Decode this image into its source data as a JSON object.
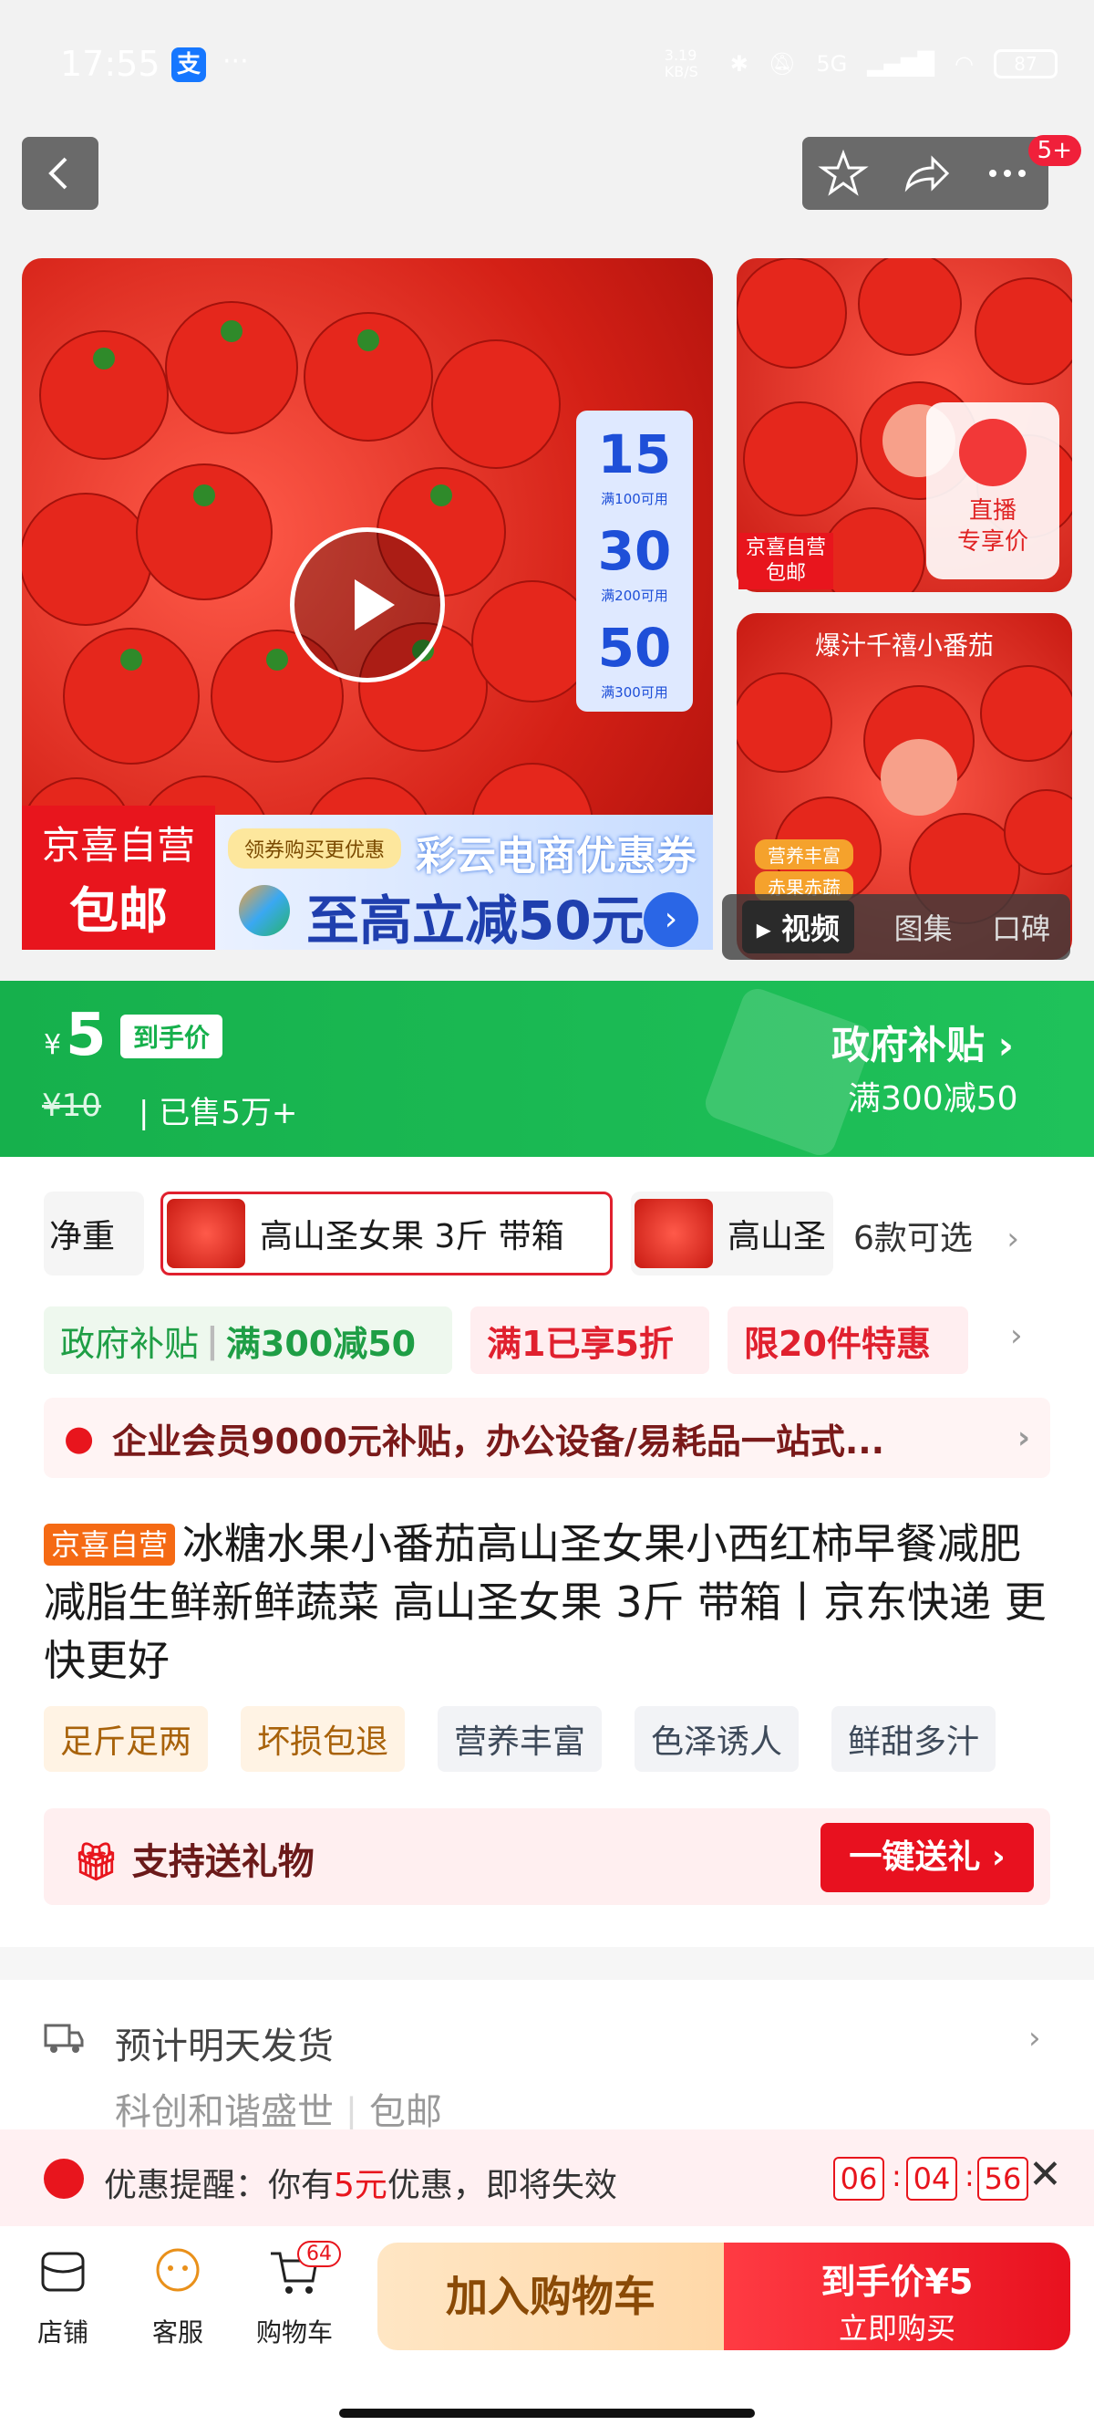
{
  "status_bar": {
    "time": "17:55",
    "alipay_icon": "支",
    "more": "···",
    "net_speed": "3.19 KB/S",
    "signal": "5G",
    "battery": "87"
  },
  "nav": {
    "badge": "5+"
  },
  "gallery": {
    "coupons": [
      {
        "value": "15",
        "cond": "满100可用"
      },
      {
        "value": "30",
        "cond": "满200可用"
      },
      {
        "value": "50",
        "cond": "满300可用"
      }
    ],
    "currency_small": "¥",
    "jx_line1": "京喜自营",
    "jx_line2": "包邮",
    "coupon_small": "领券购买更优惠",
    "coupon_title": "彩云电商优惠券",
    "coupon_main": "至高立减50元",
    "live_line1": "直播",
    "live_line2": "专享价",
    "side1_tag_l1": "京喜自营",
    "side1_tag_l2": "包邮",
    "side2_title": "爆汁千禧小番茄",
    "side2_tag1": "营养丰富",
    "side2_tag2": "赤果赤蔬",
    "tabs": [
      "视频",
      "图集",
      "口碑"
    ]
  },
  "price": {
    "currency": "¥",
    "value": "5",
    "tag": "到手价",
    "original": "¥10",
    "sold": "| 已售5万+",
    "gov_title": "政府补贴",
    "gov_sub": "满300减50"
  },
  "variants": {
    "chip0": "净重",
    "chip1": "高山圣女果 3斤 带箱",
    "chip2": "高山圣",
    "more": "6款可选"
  },
  "promos": {
    "gov": "政府补贴",
    "gov_detail": "满300减50",
    "p1": "满1已享5折",
    "p2": "限20件特惠"
  },
  "enterprise": "企业会员9000元补贴，办公设备/易耗品一站式...",
  "product": {
    "self_tag": "京喜自营",
    "title": "冰糖水果小番茄高山圣女果小西红柿早餐减肥减脂生鲜新鲜蔬菜 高山圣女果 3斤 带箱丨京东快递 更快更好"
  },
  "features": [
    "足斤足两",
    "坏损包退",
    "营养丰富",
    "色泽诱人",
    "鲜甜多汁"
  ],
  "gift": {
    "label": "支持送礼物",
    "button": "一键送礼 ›"
  },
  "shipping": {
    "line1": "预计明天发货",
    "line2_a": "科创和谐盛世",
    "line2_b": "包邮"
  },
  "reminder": {
    "prefix": "优惠提醒：你有",
    "amount": "5元",
    "suffix": "优惠，即将失效",
    "hh": "06",
    "mm": "04",
    "ss": "56"
  },
  "bottom": {
    "store": "店铺",
    "service": "客服",
    "cart": "购物车",
    "cart_count": "64",
    "add_cart": "加入购物车",
    "buy_l1": "到手价¥5",
    "buy_l2": "立即购买"
  }
}
